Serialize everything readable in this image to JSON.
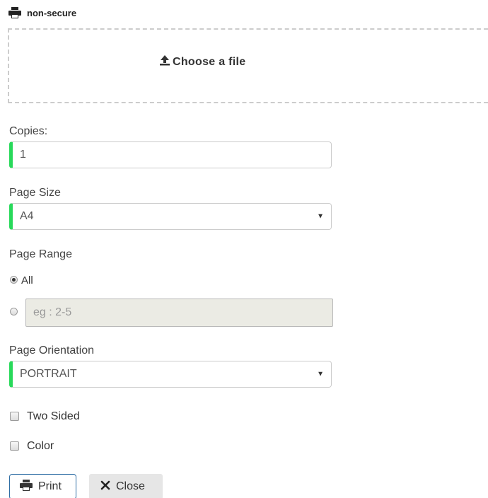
{
  "header": {
    "title": "non-secure",
    "icon": "printer-icon"
  },
  "dropzone": {
    "label": "Choose a file",
    "icon": "upload-icon"
  },
  "copies": {
    "label": "Copies:",
    "value": "1"
  },
  "page_size": {
    "label": "Page Size",
    "selected": "A4"
  },
  "page_range": {
    "label": "Page Range",
    "option_all": "All",
    "option_all_checked": true,
    "custom_placeholder": "eg : 2-5"
  },
  "orientation": {
    "label": "Page Orientation",
    "selected": "PORTRAIT"
  },
  "options": {
    "two_sided": "Two Sided",
    "two_sided_checked": false,
    "color": "Color",
    "color_checked": false
  },
  "buttons": {
    "print": "Print",
    "close": "Close"
  },
  "colors": {
    "accent_green": "#28d95a",
    "print_border": "#2e6da4",
    "close_bg": "#e6e6e6"
  }
}
